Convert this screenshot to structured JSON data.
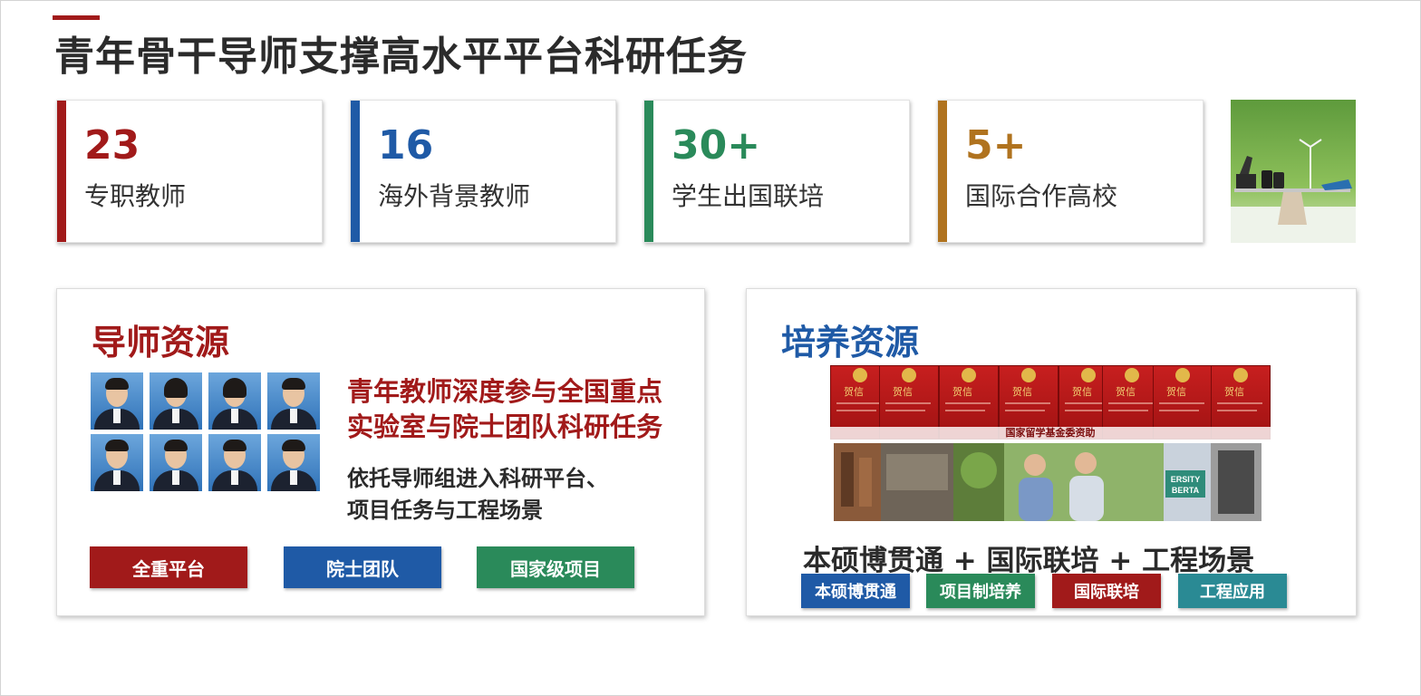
{
  "title": "青年骨干导师支撑高水平平台科研任务",
  "stats": [
    {
      "number": "23",
      "label": "专职教师",
      "color": "#a11a1a"
    },
    {
      "number": "16",
      "label": "海外背景教师",
      "color": "#1f5aa6"
    },
    {
      "number": "30+",
      "label": "学生出国联培",
      "color": "#2a8a5a"
    },
    {
      "number": "5+",
      "label": "国际合作高校",
      "color": "#b0731f"
    }
  ],
  "mentor_panel": {
    "title": "导师资源",
    "headline": [
      "青年教师深度参与全国重点",
      "实验室与院士团队科研任务"
    ],
    "subtext": [
      "依托导师组进入科研平台、",
      "项目任务与工程场景"
    ],
    "tags": [
      {
        "label": "全重平台",
        "color": "#a11a1a"
      },
      {
        "label": "院士团队",
        "color": "#1f5aa6"
      },
      {
        "label": "国家级项目",
        "color": "#2a8a5a"
      }
    ]
  },
  "training_panel": {
    "title": "培养资源",
    "slogan": "本硕博贯通 + 国际联培 + 工程场景",
    "tags": [
      {
        "label": "本硕博贯通",
        "color": "#1f5aa6"
      },
      {
        "label": "项目制培养",
        "color": "#2a8a5a"
      },
      {
        "label": "国际联培",
        "color": "#a11a1a"
      },
      {
        "label": "工程应用",
        "color": "#2a8a94"
      }
    ],
    "letter_heading": "贺信",
    "banner_text": "国家留学基金委资助",
    "sign_text": "ERSITY BERTA"
  }
}
